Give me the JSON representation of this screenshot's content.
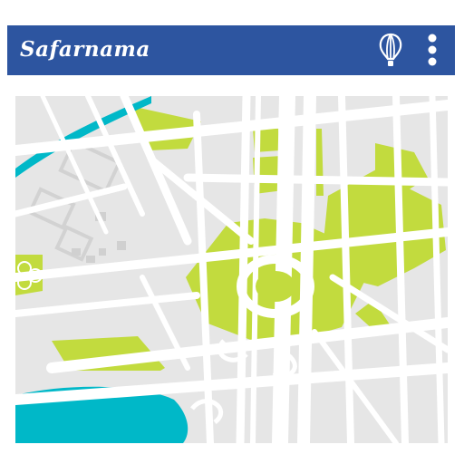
{
  "app": {
    "title": "Safarnama",
    "icons": {
      "balloon": "hot-air-balloon-icon",
      "menu": "more-vertical-icon"
    },
    "colors": {
      "appbar": "#2d55a0",
      "map_background": "#e6e6e6",
      "roads": "#ffffff",
      "parks": "#c2db3e",
      "water": "#00b8c8",
      "buildings": "#d0d0d0"
    }
  }
}
